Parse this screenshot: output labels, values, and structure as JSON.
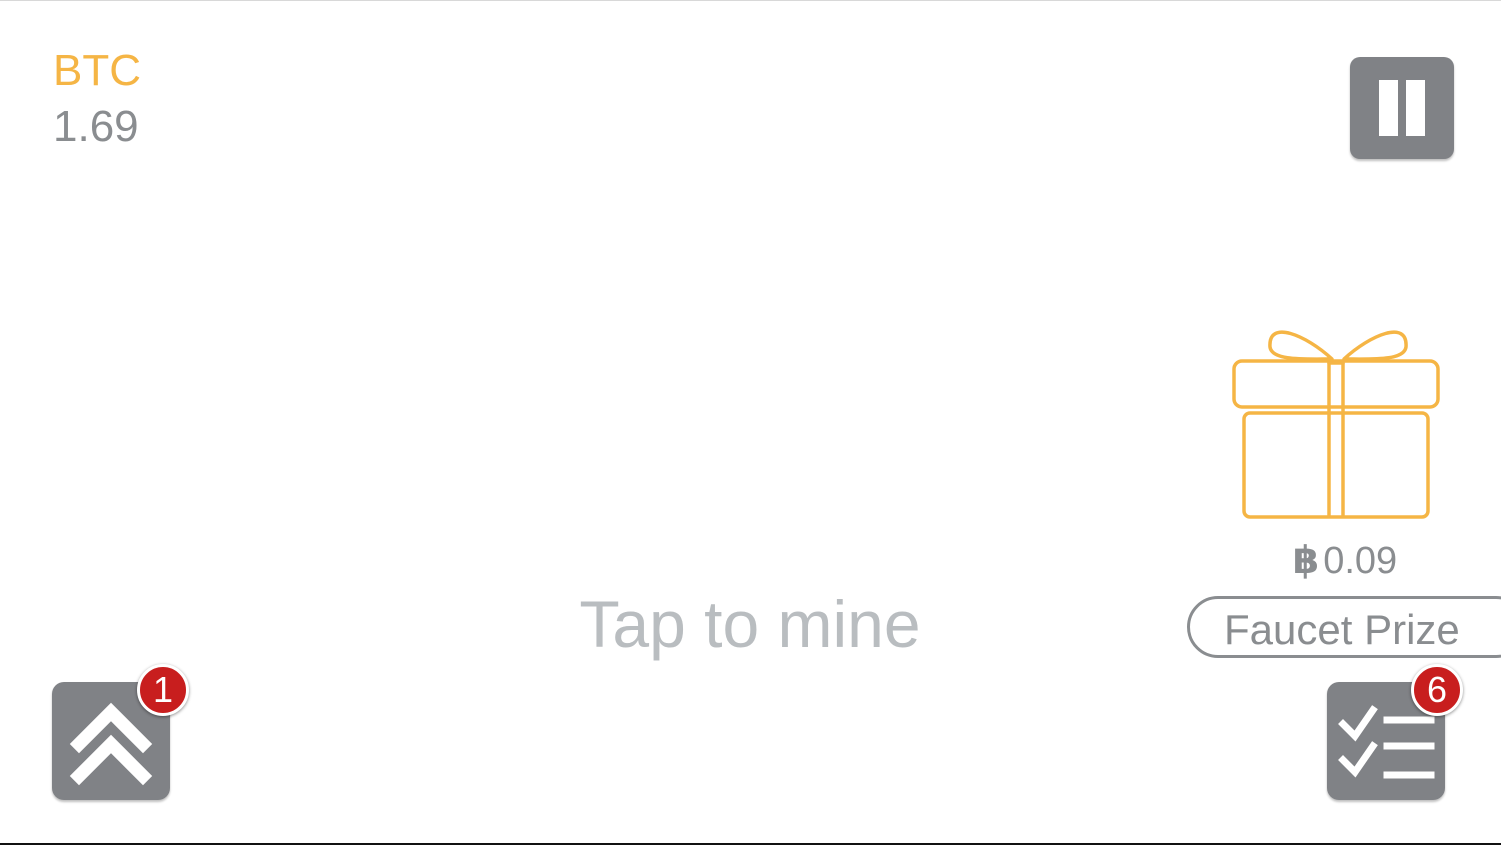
{
  "wallet": {
    "currency": "BTC",
    "balance": "1.69"
  },
  "main": {
    "hint": "Tap to mine"
  },
  "faucet": {
    "symbol": "฿",
    "amount": "0.09",
    "button_label": "Faucet Prize",
    "icon": "gift-icon"
  },
  "controls": {
    "pause_icon": "pause-icon",
    "upgrade_icon": "double-chevron-up-icon",
    "upgrade_badge": "1",
    "tasks_icon": "checklist-icon",
    "tasks_badge": "6"
  },
  "colors": {
    "accent": "#f5b545",
    "button_gray": "#808286",
    "text_gray": "#8a8d90",
    "hint_gray": "#b9bdc0",
    "badge_red": "#c81e1e"
  }
}
